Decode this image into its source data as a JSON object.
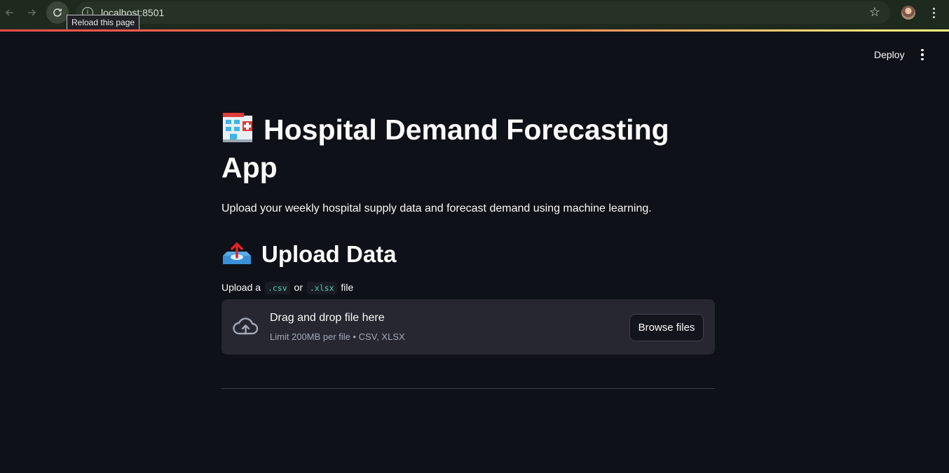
{
  "browser": {
    "url": "localhost:8501",
    "tooltip": "Reload this page",
    "colors": {
      "frame": "#1f2a1e",
      "omnibox": "#263225"
    }
  },
  "toolbar": {
    "deploy_label": "Deploy"
  },
  "main": {
    "title": "Hospital Demand Forecasting App",
    "title_icon": "hospital-emoji",
    "subtitle": "Upload your weekly hospital supply data and forecast demand using machine learning.",
    "upload_heading": "Upload Data",
    "upload_heading_icon": "outbox-tray-emoji",
    "uploader": {
      "label_prefix": "Upload a",
      "ext_csv": ".csv",
      "label_or": "or",
      "ext_xlsx": ".xlsx",
      "label_suffix": "file",
      "dropzone_title": "Drag and drop file here",
      "dropzone_limit": "Limit 200MB per file • CSV, XLSX",
      "browse_label": "Browse files",
      "icon": "cloud-upload-icon"
    }
  },
  "colors": {
    "background": "#0e1117",
    "dropzone": "#262730",
    "accent_bar_start": "#ff4b4b",
    "accent_bar_end": "#fffd80",
    "code_text": "#4dd4a4"
  }
}
